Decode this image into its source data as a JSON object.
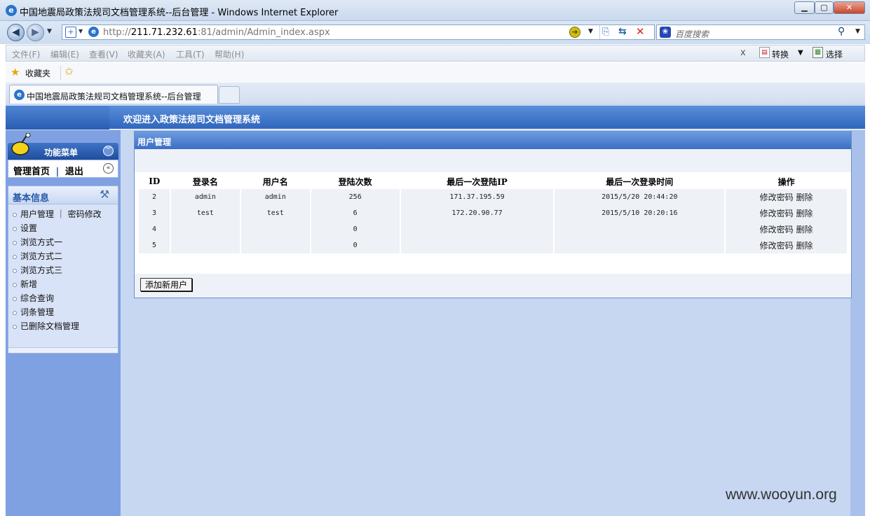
{
  "window": {
    "title": "中国地震局政策法规司文档管理系统--后台管理 - Windows Internet Explorer",
    "minimize": "▁",
    "maximize": "▢",
    "close": "✕"
  },
  "address": {
    "url_prefix": "http://",
    "url_host": "211.71.232.61",
    "url_rest": ":81/admin/Admin_index.aspx",
    "search_placeholder": "百度搜索"
  },
  "menu": [
    "文件(F)",
    "编辑(E)",
    "查看(V)",
    "收藏夹(A)",
    "工具(T)",
    "帮助(H)"
  ],
  "toolbar_right": {
    "close_x": "x",
    "convert": "转换",
    "select": "选择"
  },
  "favorites": {
    "label": "收藏夹"
  },
  "tab": {
    "title": "中国地震局政策法规司文档管理系统--后台管理"
  },
  "banner": {
    "title": "欢迎进入政策法规司文档管理系统"
  },
  "sidebar": {
    "menu_title": "功能菜单",
    "home": "管理首页",
    "separator": "|",
    "logout": "退出",
    "section_title": "基本信息",
    "items": [
      {
        "label": "用户管理 ｜ 密码修改"
      },
      {
        "label": "设置"
      },
      {
        "label": "浏览方式一"
      },
      {
        "label": "浏览方式二"
      },
      {
        "label": "浏览方式三"
      },
      {
        "label": "新增"
      },
      {
        "label": "综合查询"
      },
      {
        "label": "词条管理"
      },
      {
        "label": "已删除文档管理"
      }
    ]
  },
  "panel": {
    "title": "用户管理",
    "columns": [
      "ID",
      "登录名",
      "用户名",
      "登陆次数",
      "最后一次登陆IP",
      "最后一次登录时间",
      "操作"
    ],
    "rows": [
      {
        "id": "2",
        "login": "admin",
        "name": "admin",
        "count": "256",
        "ip": "171.37.195.59",
        "time": "2015/5/20 20:44:20"
      },
      {
        "id": "3",
        "login": "test",
        "name": "test",
        "count": "6",
        "ip": "172.20.90.77",
        "time": "2015/5/10 20:20:16"
      },
      {
        "id": "4",
        "login": "",
        "name": "",
        "count": "0",
        "ip": "",
        "time": ""
      },
      {
        "id": "5",
        "login": "",
        "name": "",
        "count": "0",
        "ip": "",
        "time": ""
      }
    ],
    "op_edit": "修改密码",
    "op_delete": "删除",
    "add_button": "添加新用户"
  },
  "watermark": "www.wooyun.org"
}
